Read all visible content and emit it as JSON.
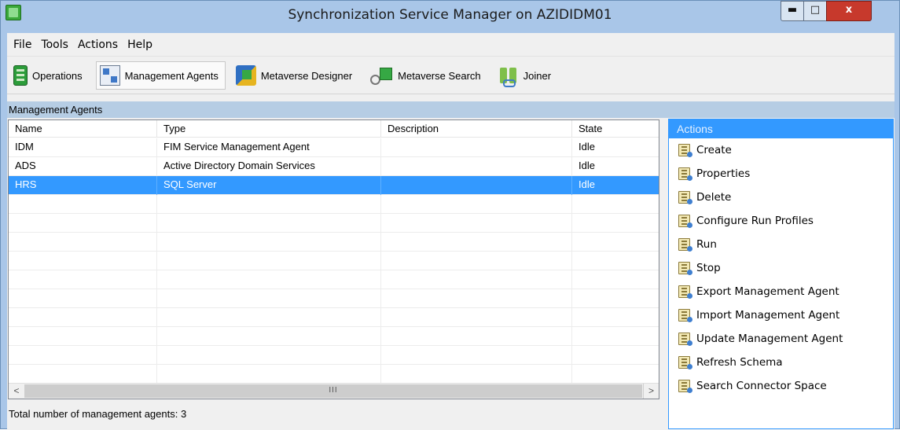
{
  "window": {
    "title": "Synchronization Service Manager on AZIDIDM01",
    "min_glyph": "▬",
    "max_glyph": "□",
    "close_glyph": "x"
  },
  "menu": [
    "File",
    "Tools",
    "Actions",
    "Help"
  ],
  "toolbar": {
    "items": [
      {
        "label": "Operations",
        "icon": "operations-icon",
        "active": false
      },
      {
        "label": "Management Agents",
        "icon": "management-agents-icon",
        "active": true
      },
      {
        "label": "Metaverse Designer",
        "icon": "metaverse-designer-icon",
        "active": false
      },
      {
        "label": "Metaverse Search",
        "icon": "metaverse-search-icon",
        "active": false
      },
      {
        "label": "Joiner",
        "icon": "joiner-icon",
        "active": false
      }
    ]
  },
  "section_title": "Management Agents",
  "grid": {
    "columns": [
      "Name",
      "Type",
      "Description",
      "State"
    ],
    "rows": [
      {
        "name": "IDM",
        "type": "FIM Service Management Agent",
        "description": "",
        "state": "Idle",
        "selected": false
      },
      {
        "name": "ADS",
        "type": "Active Directory Domain Services",
        "description": "",
        "state": "Idle",
        "selected": false
      },
      {
        "name": "HRS",
        "type": "SQL Server",
        "description": "",
        "state": "Idle",
        "selected": true
      }
    ],
    "empty_rows": 10,
    "scroll_left": "<",
    "scroll_right": ">",
    "scroll_thumb": "III"
  },
  "status": "Total number of management agents: 3",
  "actions": {
    "title": "Actions",
    "items": [
      "Create",
      "Properties",
      "Delete",
      "Configure Run Profiles",
      "Run",
      "Stop",
      "Export Management Agent",
      "Import Management Agent",
      "Update Management Agent",
      "Refresh Schema",
      "Search Connector Space"
    ]
  },
  "colors": {
    "selection": "#3399ff",
    "titlebar": "#a9c6e8",
    "section_header": "#b6cde4"
  }
}
